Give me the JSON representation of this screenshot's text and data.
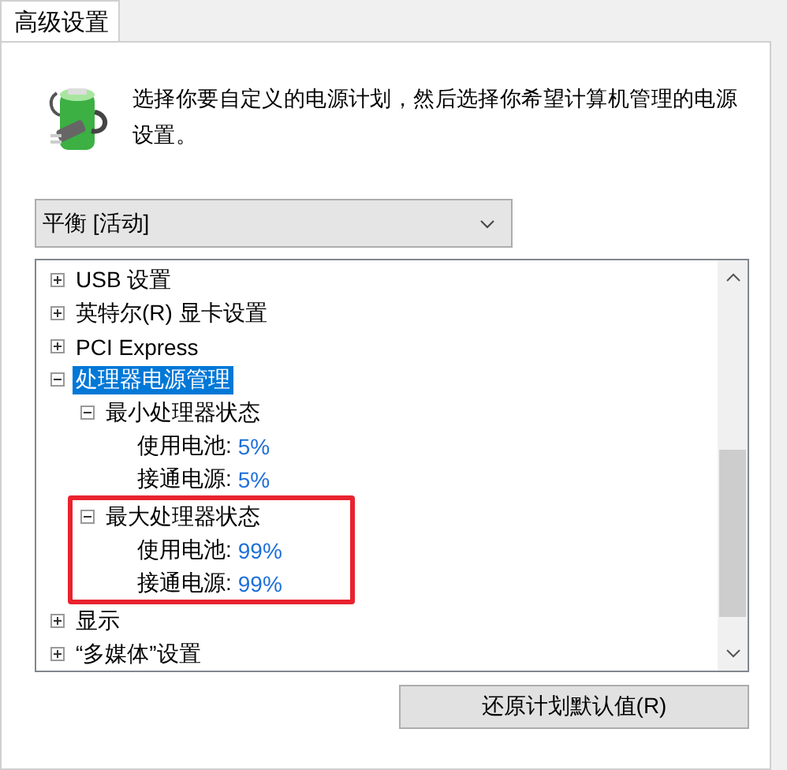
{
  "tabs": [
    {
      "label": "高级设置",
      "selected": true
    }
  ],
  "description": "选择你要自定义的电源计划，然后选择你希望计算机管理的电源设置。",
  "plan_dropdown": {
    "value": "平衡 [活动]"
  },
  "settings_tree": [
    {
      "label": "USB 设置",
      "expanded": false,
      "selected": false
    },
    {
      "label": "英特尔(R) 显卡设置",
      "expanded": false,
      "selected": false
    },
    {
      "label": "PCI Express",
      "expanded": false,
      "selected": false
    },
    {
      "label": "处理器电源管理",
      "expanded": true,
      "selected": true,
      "children": [
        {
          "label": "最小处理器状态",
          "expanded": true,
          "highlighted": false,
          "children": [
            {
              "label": "使用电池:",
              "value": "5%"
            },
            {
              "label": "接通电源:",
              "value": "5%"
            }
          ]
        },
        {
          "label": "最大处理器状态",
          "expanded": true,
          "highlighted": true,
          "children": [
            {
              "label": "使用电池:",
              "value": "99%"
            },
            {
              "label": "接通电源:",
              "value": "99%"
            }
          ]
        }
      ]
    },
    {
      "label": "显示",
      "expanded": false,
      "selected": false
    },
    {
      "label": "“多媒体”设置",
      "expanded": false,
      "selected": false
    }
  ],
  "buttons": [
    "还原计划默认值(R)"
  ]
}
